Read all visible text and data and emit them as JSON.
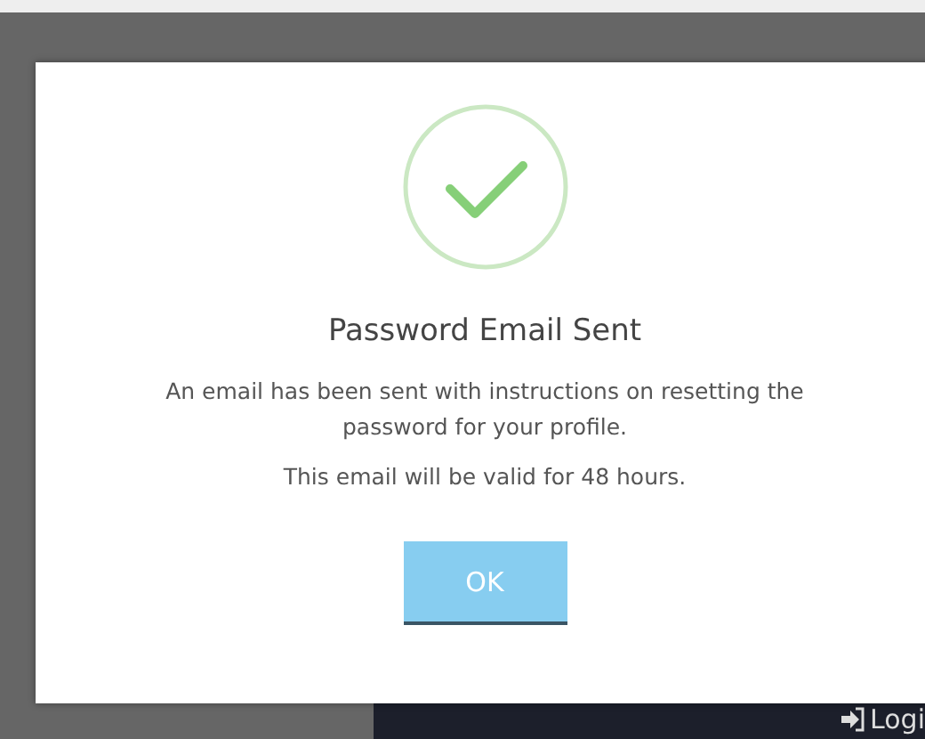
{
  "page": {
    "login_link": "Logi"
  },
  "dialog": {
    "title": "Password Email Sent",
    "messages": [
      "An email has been sent with instructions on resetting the password for your profile.",
      "This email will be valid for 48 hours."
    ],
    "button": "OK"
  }
}
